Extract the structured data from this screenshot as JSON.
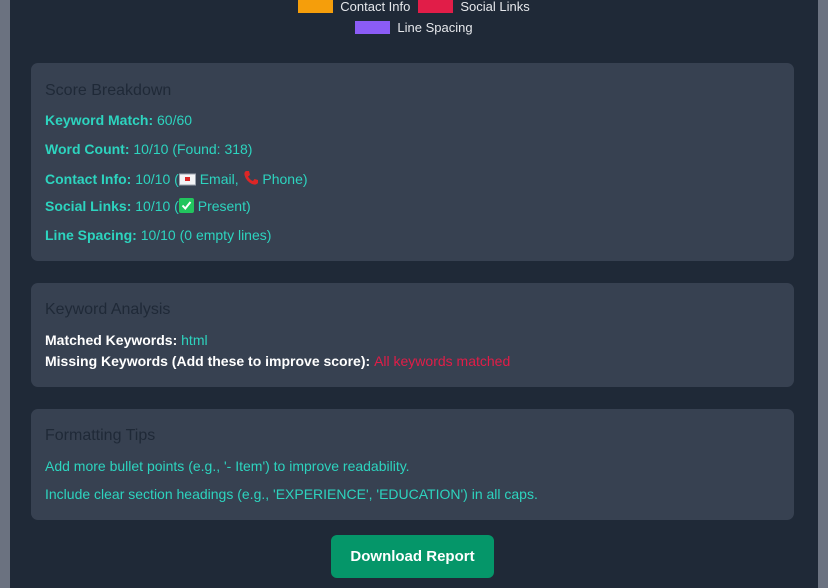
{
  "legend": [
    {
      "label": "Contact Info",
      "color": "#f59e0b",
      "border": "#f59e0b"
    },
    {
      "label": "Social Links",
      "color": "#e11d48",
      "border": "#e11d48"
    },
    {
      "label": "Line Spacing",
      "color": "#8b5cf6",
      "border": "#8b5cf6"
    }
  ],
  "score_breakdown": {
    "title": "Score Breakdown",
    "rows": [
      {
        "label": "Keyword Match:",
        "value": "60/60"
      },
      {
        "label": "Word Count:",
        "value": "10/10 (Found: 318)"
      },
      {
        "label": "Contact Info:",
        "value_prefix": "10/10 (",
        "email": "Email,",
        "phone": "Phone)"
      },
      {
        "label": "Social Links:",
        "value_prefix": "10/10 (",
        "value_suffix": "Present)"
      },
      {
        "label": "Line Spacing:",
        "value": "10/10 (0 empty lines)"
      }
    ]
  },
  "keyword_analysis": {
    "title": "Keyword Analysis",
    "matched_label": "Matched Keywords:",
    "matched_value": "html",
    "missing_label": "Missing Keywords (Add these to improve score):",
    "missing_value": "All keywords matched"
  },
  "formatting_tips": {
    "title": "Formatting Tips",
    "tips": [
      "Add more bullet points (e.g., '- Item') to improve readability.",
      "Include clear section headings (e.g., 'EXPERIENCE', 'EDUCATION') in all caps."
    ]
  },
  "download_button": {
    "label": "Download Report"
  },
  "icons": {
    "email": "envelope-icon",
    "phone": "telephone-icon",
    "present": "check-mark-icon"
  }
}
